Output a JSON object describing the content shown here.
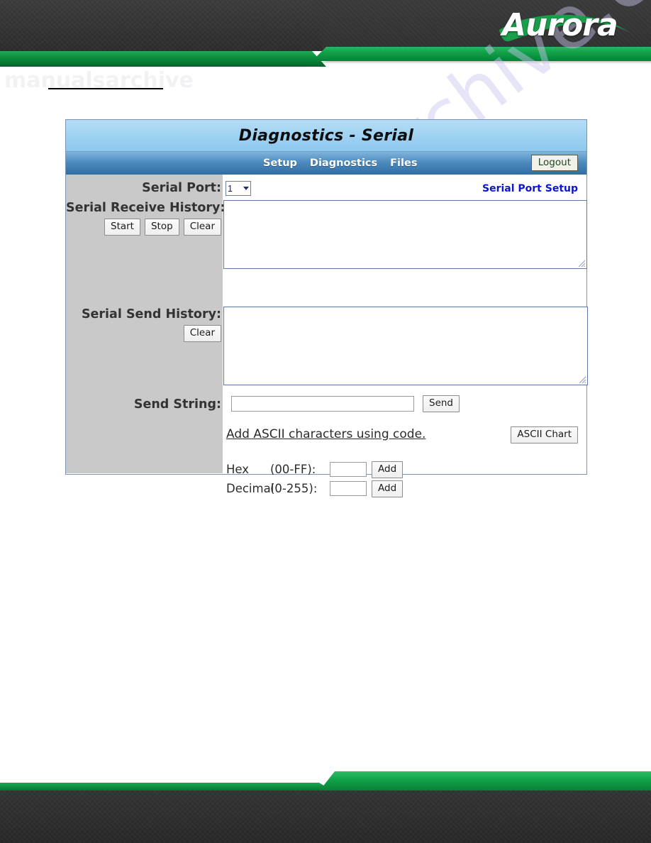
{
  "brand": {
    "logo_text": "Aurora",
    "accent_green": "#0f9140",
    "header_dark": "#333333"
  },
  "watermarks": {
    "diagonal": "manualsarchive.com",
    "top_left": "manualsarchive"
  },
  "panel": {
    "title": "Diagnostics - Serial",
    "nav": {
      "items": [
        {
          "label": "Setup"
        },
        {
          "label": "Diagnostics"
        },
        {
          "label": "Files"
        }
      ],
      "logout_label": "Logout"
    },
    "serial_port": {
      "label": "Serial Port:",
      "selected": "1",
      "options": [
        "1"
      ],
      "setup_link": "Serial Port Setup",
      "link_color": "#0d16c8"
    },
    "receive_history": {
      "label": "Serial Receive History:",
      "value": "",
      "buttons": [
        {
          "label": "Start"
        },
        {
          "label": "Stop"
        },
        {
          "label": "Clear"
        }
      ]
    },
    "send_history": {
      "label": "Serial Send History:",
      "value": "",
      "buttons": [
        {
          "label": "Clear"
        }
      ]
    },
    "send_string": {
      "label": "Send String:",
      "value": "",
      "placeholder": "",
      "button_label": "Send"
    },
    "ascii": {
      "hint": "Add ASCII characters using code.",
      "chart_button": "ASCII Chart",
      "hex": {
        "name": "Hex",
        "range": "(00-FF):",
        "value": "",
        "add_label": "Add"
      },
      "decimal": {
        "name": "Decimal",
        "range": "(0-255):",
        "value": "",
        "add_label": "Add"
      }
    }
  }
}
